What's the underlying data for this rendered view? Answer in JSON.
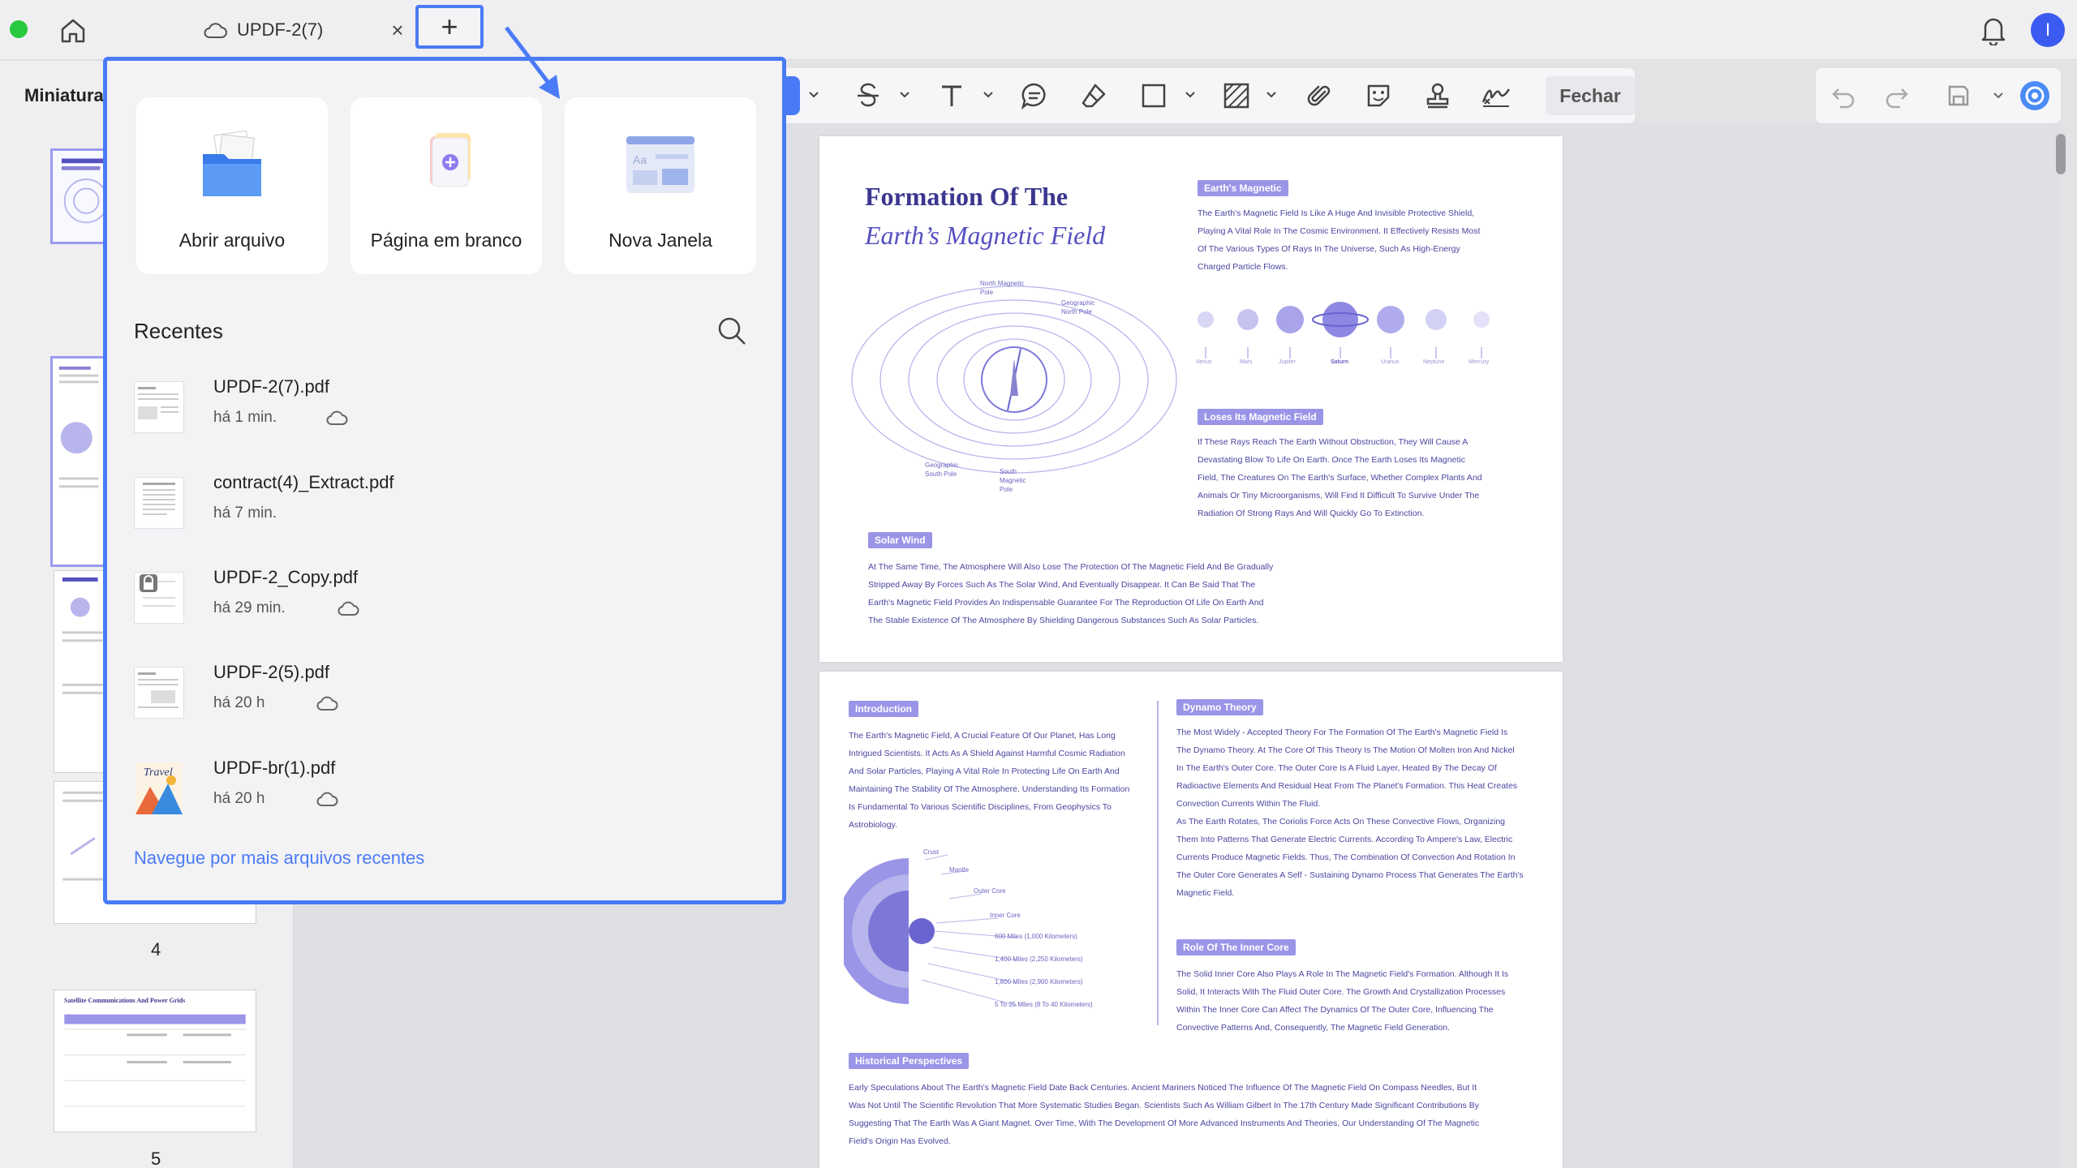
{
  "titlebar": {
    "tab_title": "UPDF-2(7)",
    "close_symbol": "×",
    "new_tab_symbol": "+",
    "avatar_initial": "I"
  },
  "sidebar": {
    "title": "Miniaturas",
    "page_numbers": [
      "4",
      "5"
    ]
  },
  "toolbar": {
    "close_label": "Fechar"
  },
  "popup": {
    "actions": [
      {
        "label": "Abrir arquivo",
        "icon": "folder-icon"
      },
      {
        "label": "Página em branco",
        "icon": "blank-page-icon"
      },
      {
        "label": "Nova Janela",
        "icon": "new-window-icon"
      }
    ],
    "recents_title": "Recentes",
    "recents": [
      {
        "name": "UPDF-2(7).pdf",
        "time": "há 1 min.",
        "cloud": true
      },
      {
        "name": "contract(4)_Extract.pdf",
        "time": "há 7 min.",
        "cloud": false
      },
      {
        "name": "UPDF-2_Copy.pdf",
        "time": "há 29 min.",
        "cloud": true
      },
      {
        "name": "UPDF-2(5).pdf",
        "time": "há 20 h",
        "cloud": true
      },
      {
        "name": "UPDF-br(1).pdf",
        "time": "há 20 h",
        "cloud": true
      }
    ],
    "more_link": "Navegue por mais arquivos recentes"
  },
  "document": {
    "page1": {
      "title_line1": "Formation Of The",
      "title_line2": "Earth’s Magnetic Field",
      "tag_earth": "Earth's Magnetic",
      "earth_text": [
        "The Earth's Magnetic Field Is Like A Huge And Invisible Protective Shield,",
        "Playing A Vital Role In The Cosmic Environment. It Effectively Resists Most",
        "Of The Various Types Of Rays In The Universe, Such As High-Energy",
        "Charged Particle Flows."
      ],
      "planets": [
        "Venus",
        "Mars",
        "Jupiter",
        "Saturn",
        "Uranus",
        "Neptune",
        "Mercury"
      ],
      "tag_loses": "Loses Its Magnetic Field",
      "loses_text": [
        "If These Rays Reach The Earth Without Obstruction, They Will Cause A",
        "Devastating Blow To Life On Earth. Once The Earth Loses Its Magnetic",
        "Field, The Creatures On The Earth's Surface, Whether Complex Plants And",
        "Animals Or Tiny Microorganisms, Will Find It Difficult To Survive Under The",
        "Radiation Of Strong Rays And Will Quickly Go To Extinction."
      ],
      "tag_solar": "Solar Wind",
      "solar_text": [
        "At The Same Time, The Atmosphere Will Also Lose The Protection Of The Magnetic Field And Be Gradually",
        "Stripped Away By Forces Such As The Solar Wind, And Eventually Disappear. It Can Be Said That The",
        "Earth's Magnetic Field Provides An Indispensable Guarantee For The Reproduction Of Life On Earth And",
        "The Stable Existence Of The Atmosphere By Shielding Dangerous Substances Such As Solar Particles."
      ],
      "pole_labels": [
        "North Magnetic Pole",
        "Geographic North Pole",
        "Geographic South Pole",
        "South Magnetic Pole"
      ]
    },
    "page2": {
      "tag_intro": "Introduction",
      "intro_text": [
        "The Earth's Magnetic Field, A Crucial Feature Of Our Planet, Has Long",
        "Intrigued Scientists. It Acts As A Shield Against Harmful Cosmic Radiation",
        "And Solar Particles, Playing A Vital Role In Protecting Life On Earth And",
        "Maintaining The Stability Of The Atmosphere. Understanding Its Formation",
        "Is Fundamental To Various Scientific Disciplines, From Geophysics To",
        "Astrobiology."
      ],
      "tag_dynamo": "Dynamo Theory",
      "dynamo_text": [
        "The Most Widely - Accepted Theory For The Formation Of The Earth's Magnetic Field Is",
        "The Dynamo Theory. At The Core Of This Theory Is The Motion Of Molten Iron And Nickel",
        "In The Earth's Outer Core. The Outer Core Is A Fluid Layer, Heated By The Decay Of",
        "Radioactive Elements And Residual Heat From The Planet's Formation. This Heat Creates",
        "Convection Currents Within The Fluid.",
        "As The Earth Rotates, The Coriolis Force Acts On These Convective Flows, Organizing",
        "Them Into Patterns That Generate Electric Currents. According To Ampere's Law, Electric",
        "Currents Produce Magnetic Fields. Thus, The Combination Of Convection And Rotation In",
        "The Outer Core Generates A Self - Sustaining Dynamo Process That Generates The Earth's",
        "Magnetic Field."
      ],
      "layers": [
        "Crust",
        "Mantle",
        "Outer Core",
        "Inner Core"
      ],
      "depths": [
        "600 Miles (1,000 Kilometers)",
        "1,400 Miles (2,250 Kilometers)",
        "1,800 Miles (2,900 Kilometers)",
        "5 To 25 Miles (8 To 40 Kilometers)"
      ],
      "tag_inner": "Role Of The Inner Core",
      "inner_text": [
        "The Solid Inner Core Also Plays A Role In The Magnetic Field's Formation. Although It Is",
        "Solid, It Interacts With The Fluid Outer Core. The Growth And Crystallization Processes",
        "Within The Inner Core Can Affect The Dynamics Of The Outer Core, Influencing The",
        "Convective Patterns And, Consequently, The Magnetic Field Generation."
      ],
      "tag_hist": "Historical Perspectives",
      "hist_text": [
        "Early Speculations About The Earth's Magnetic Field Date Back Centuries. Ancient Mariners Noticed The Influence Of The Magnetic Field On Compass Needles, But It",
        "Was Not Until The Scientific Revolution That More Systematic Studies Began. Scientists Such As William Gilbert In The 17th Century Made Significant Contributions By",
        "Suggesting That The Earth Was A Giant Magnet. Over Time, With The Development Of More Advanced Instruments And Theories, Our Understanding Of The Magnetic",
        "Field's Origin Has Evolved."
      ]
    },
    "thumb_titles": [
      "Satellite Communications And Power Grids"
    ]
  },
  "colors": {
    "accent": "#4a7bf7",
    "doc_purple": "#3b3790",
    "tag_purple": "#9b95e8"
  }
}
